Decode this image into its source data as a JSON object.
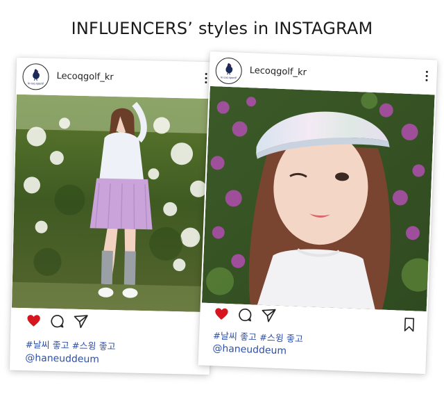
{
  "headline": "INFLUENCERS’ styles in INSTAGRAM",
  "colors": {
    "accent_text": "#2c4fa8",
    "like": "#d6161e",
    "logo_navy": "#1c2a5a"
  },
  "posts": [
    {
      "username": "Lecoqgolf_kr",
      "avatar_text": "le coq sportif",
      "hashtags": "#날씨 좋고 #스윙 좋고",
      "handle": "@haneuddeum",
      "liked": true,
      "icons": [
        "heart-icon",
        "comment-icon",
        "share-icon"
      ],
      "photo": "Woman in pink pleated skirt and white jacket posing in front of flowering bushes"
    },
    {
      "username": "Lecoqgolf_kr",
      "avatar_text": "le coq sportif",
      "hashtags": "#날씨 좋고 #스윙 좋고",
      "handle": "@haneuddeum",
      "liked": true,
      "icons": [
        "heart-icon",
        "comment-icon",
        "share-icon",
        "bookmark-icon"
      ],
      "photo": "Woman wearing iridescent visor winking in front of purple azaleas"
    }
  ]
}
